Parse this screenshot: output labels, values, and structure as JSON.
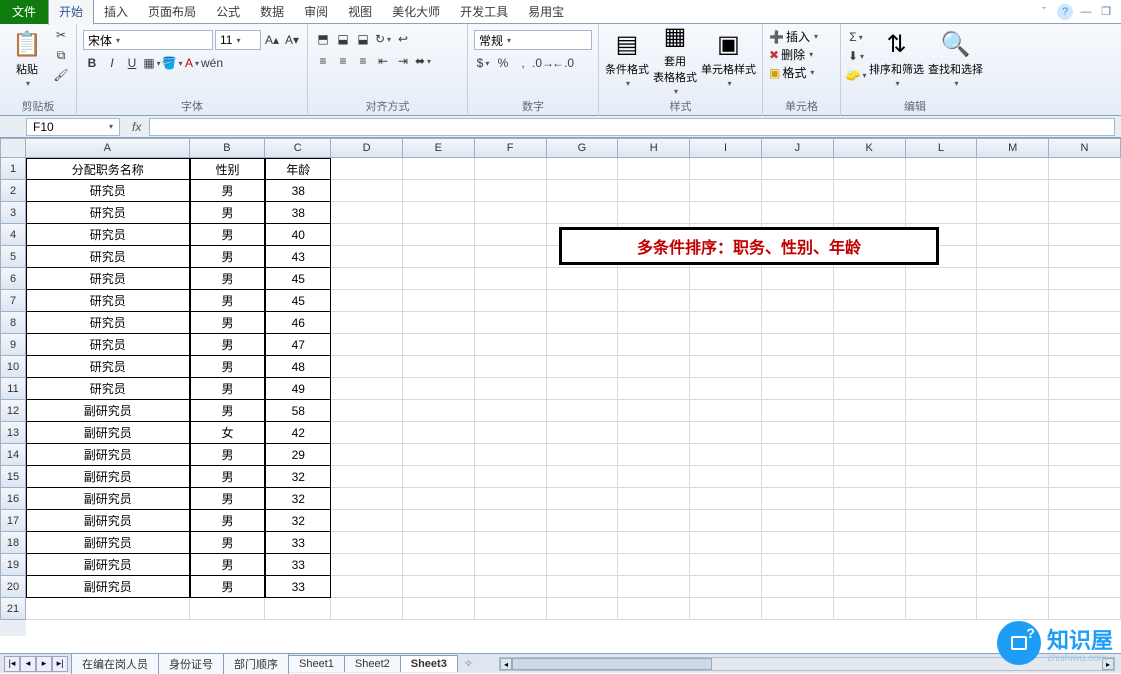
{
  "tabs": {
    "file": "文件",
    "items": [
      "开始",
      "插入",
      "页面布局",
      "公式",
      "数据",
      "审阅",
      "视图",
      "美化大师",
      "开发工具",
      "易用宝"
    ],
    "active_index": 0
  },
  "ribbon": {
    "clipboard": {
      "paste": "粘贴",
      "label": "剪贴板"
    },
    "font": {
      "name": "宋体",
      "size": "11",
      "label": "字体"
    },
    "align": {
      "label": "对齐方式"
    },
    "number": {
      "format": "常规",
      "label": "数字"
    },
    "styles": {
      "cond": "条件格式",
      "table": "套用\n表格格式",
      "cell": "单元格样式",
      "label": "样式"
    },
    "cells": {
      "insert": "插入",
      "delete": "删除",
      "format": "格式",
      "label": "单元格"
    },
    "editing": {
      "sort": "排序和筛选",
      "find": "查找和选择",
      "label": "编辑"
    }
  },
  "namebox": "F10",
  "columns": [
    "A",
    "B",
    "C",
    "D",
    "E",
    "F",
    "G",
    "H",
    "I",
    "J",
    "K",
    "L",
    "M",
    "N"
  ],
  "col_classes": [
    "cA",
    "cB",
    "cC",
    "cD",
    "cE",
    "cF",
    "cG",
    "cH",
    "cI",
    "cJ",
    "cK",
    "cL",
    "cM",
    "cN"
  ],
  "row_count": 21,
  "table": {
    "header": [
      "分配职务名称",
      "性别",
      "年龄"
    ],
    "rows": [
      [
        "研究员",
        "男",
        "38"
      ],
      [
        "研究员",
        "男",
        "38"
      ],
      [
        "研究员",
        "男",
        "40"
      ],
      [
        "研究员",
        "男",
        "43"
      ],
      [
        "研究员",
        "男",
        "45"
      ],
      [
        "研究员",
        "男",
        "45"
      ],
      [
        "研究员",
        "男",
        "46"
      ],
      [
        "研究员",
        "男",
        "47"
      ],
      [
        "研究员",
        "男",
        "48"
      ],
      [
        "研究员",
        "男",
        "49"
      ],
      [
        "副研究员",
        "男",
        "58"
      ],
      [
        "副研究员",
        "女",
        "42"
      ],
      [
        "副研究员",
        "男",
        "29"
      ],
      [
        "副研究员",
        "男",
        "32"
      ],
      [
        "副研究员",
        "男",
        "32"
      ],
      [
        "副研究员",
        "男",
        "32"
      ],
      [
        "副研究员",
        "男",
        "33"
      ],
      [
        "副研究员",
        "男",
        "33"
      ],
      [
        "副研究员",
        "男",
        "33"
      ]
    ]
  },
  "annotation": "多条件排序：职务、性别、年龄",
  "sheets": [
    "在编在岗人员",
    "身份证号",
    "部门顺序",
    "Sheet1",
    "Sheet2",
    "Sheet3"
  ],
  "active_sheet": 5,
  "logo": {
    "brand": "知识屋",
    "domain": "zhishiwu.com"
  }
}
